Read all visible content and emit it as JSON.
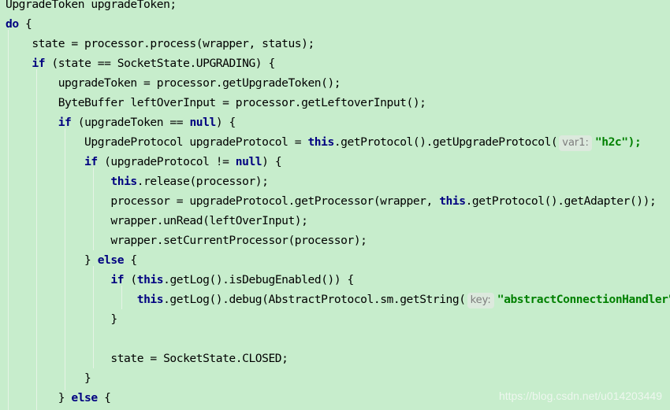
{
  "editor": {
    "lines": [
      [
        {
          "t": "UpgradeToken upgradeToken;"
        }
      ],
      [
        {
          "t": "do",
          "c": "kw"
        },
        {
          "t": " {"
        }
      ],
      [
        {
          "t": "    state = processor.process(wrapper, status);"
        }
      ],
      [
        {
          "t": "    "
        },
        {
          "t": "if",
          "c": "kw"
        },
        {
          "t": " (state == SocketState.UPGRADING) {"
        }
      ],
      [
        {
          "t": "        upgradeToken = processor.getUpgradeToken();"
        }
      ],
      [
        {
          "t": "        ByteBuffer leftOverInput = processor.getLeftoverInput();"
        }
      ],
      [
        {
          "t": "        "
        },
        {
          "t": "if",
          "c": "kw"
        },
        {
          "t": " (upgradeToken == "
        },
        {
          "t": "null",
          "c": "kw"
        },
        {
          "t": ") {"
        }
      ],
      [
        {
          "t": "            UpgradeProtocol upgradeProtocol = "
        },
        {
          "t": "this",
          "c": "kw"
        },
        {
          "t": ".getProtocol().getUpgradeProtocol("
        },
        {
          "t": "var1:",
          "c": "hint"
        },
        {
          "t": "\"h2c\");",
          "c": "str"
        }
      ],
      [
        {
          "t": "            "
        },
        {
          "t": "if",
          "c": "kw"
        },
        {
          "t": " (upgradeProtocol != "
        },
        {
          "t": "null",
          "c": "kw"
        },
        {
          "t": ") {"
        }
      ],
      [
        {
          "t": "                "
        },
        {
          "t": "this",
          "c": "kw"
        },
        {
          "t": ".release(processor);"
        }
      ],
      [
        {
          "t": "                processor = upgradeProtocol.getProcessor(wrapper, "
        },
        {
          "t": "this",
          "c": "kw"
        },
        {
          "t": ".getProtocol().getAdapter());"
        }
      ],
      [
        {
          "t": "                wrapper.unRead(leftOverInput);"
        }
      ],
      [
        {
          "t": "                wrapper.setCurrentProcessor(processor);"
        }
      ],
      [
        {
          "t": "            } "
        },
        {
          "t": "else",
          "c": "kw"
        },
        {
          "t": " {"
        }
      ],
      [
        {
          "t": "                "
        },
        {
          "t": "if",
          "c": "kw"
        },
        {
          "t": " ("
        },
        {
          "t": "this",
          "c": "kw"
        },
        {
          "t": ".getLog().isDebugEnabled()) {"
        }
      ],
      [
        {
          "t": "                    "
        },
        {
          "t": "this",
          "c": "kw"
        },
        {
          "t": ".getLog().debug(AbstractProtocol.sm.getString("
        },
        {
          "t": "key:",
          "c": "hint"
        },
        {
          "t": "\"abstractConnectionHandler\"));",
          "c": "str"
        }
      ],
      [
        {
          "t": "                }"
        }
      ],
      [
        {
          "t": ""
        }
      ],
      [
        {
          "t": "                state = SocketState.CLOSED;"
        }
      ],
      [
        {
          "t": "            }"
        }
      ],
      [
        {
          "t": "        } "
        },
        {
          "t": "else",
          "c": "kw"
        },
        {
          "t": " {"
        }
      ]
    ]
  },
  "watermark": "https://blog.csdn.net/u014203449"
}
